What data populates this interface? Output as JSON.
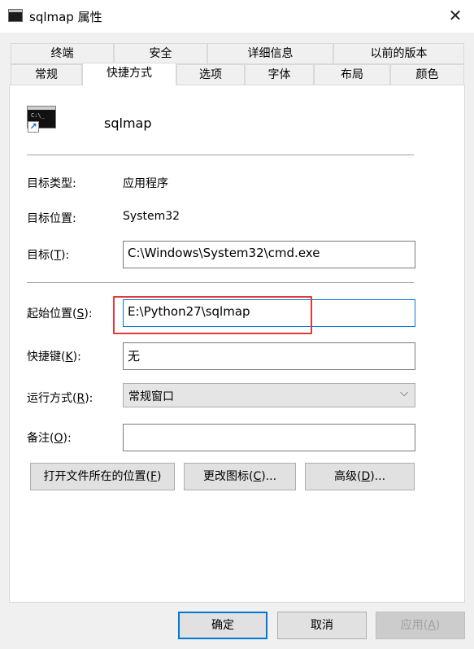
{
  "window": {
    "title": "sqlmap 属性",
    "close_glyph": "✕"
  },
  "tabs_top": [
    "终端",
    "安全",
    "详细信息",
    "以前的版本"
  ],
  "tabs_bottom": [
    "常规",
    "快捷方式",
    "选项",
    "字体",
    "布局",
    "颜色"
  ],
  "active_tab": "快捷方式",
  "shortcut": {
    "name": "sqlmap",
    "icon": "cmd-shortcut-icon",
    "target_type_label": "目标类型:",
    "target_type": "应用程序",
    "target_location_label": "目标位置:",
    "target_location": "System32",
    "target_label_pre": "目标(",
    "target_label_key": "T",
    "target_label_post": "):",
    "target": "C:\\Windows\\System32\\cmd.exe",
    "start_in_label_pre": "起始位置(",
    "start_in_label_key": "S",
    "start_in_label_post": "):",
    "start_in": "E:\\Python27\\sqlmap",
    "hotkey_label_pre": "快捷键(",
    "hotkey_label_key": "K",
    "hotkey_label_post": "):",
    "hotkey": "无",
    "run_label_pre": "运行方式(",
    "run_label_key": "R",
    "run_label_post": "):",
    "run": "常规窗口",
    "comment_label_pre": "备注(",
    "comment_label_key": "O",
    "comment_label_post": "):",
    "comment": ""
  },
  "actions": {
    "open_location_pre": "打开文件所在的位置(",
    "open_location_key": "F",
    "open_location_post": ")",
    "change_icon_pre": "更改图标(",
    "change_icon_key": "C",
    "change_icon_post": ")...",
    "advanced_pre": "高级(",
    "advanced_key": "D",
    "advanced_post": ")..."
  },
  "footer": {
    "ok": "确定",
    "cancel": "取消",
    "apply_pre": "应用(",
    "apply_key": "A",
    "apply_post": ")"
  },
  "colors": {
    "highlight": "#e03a3e",
    "focus": "#0078d7"
  }
}
